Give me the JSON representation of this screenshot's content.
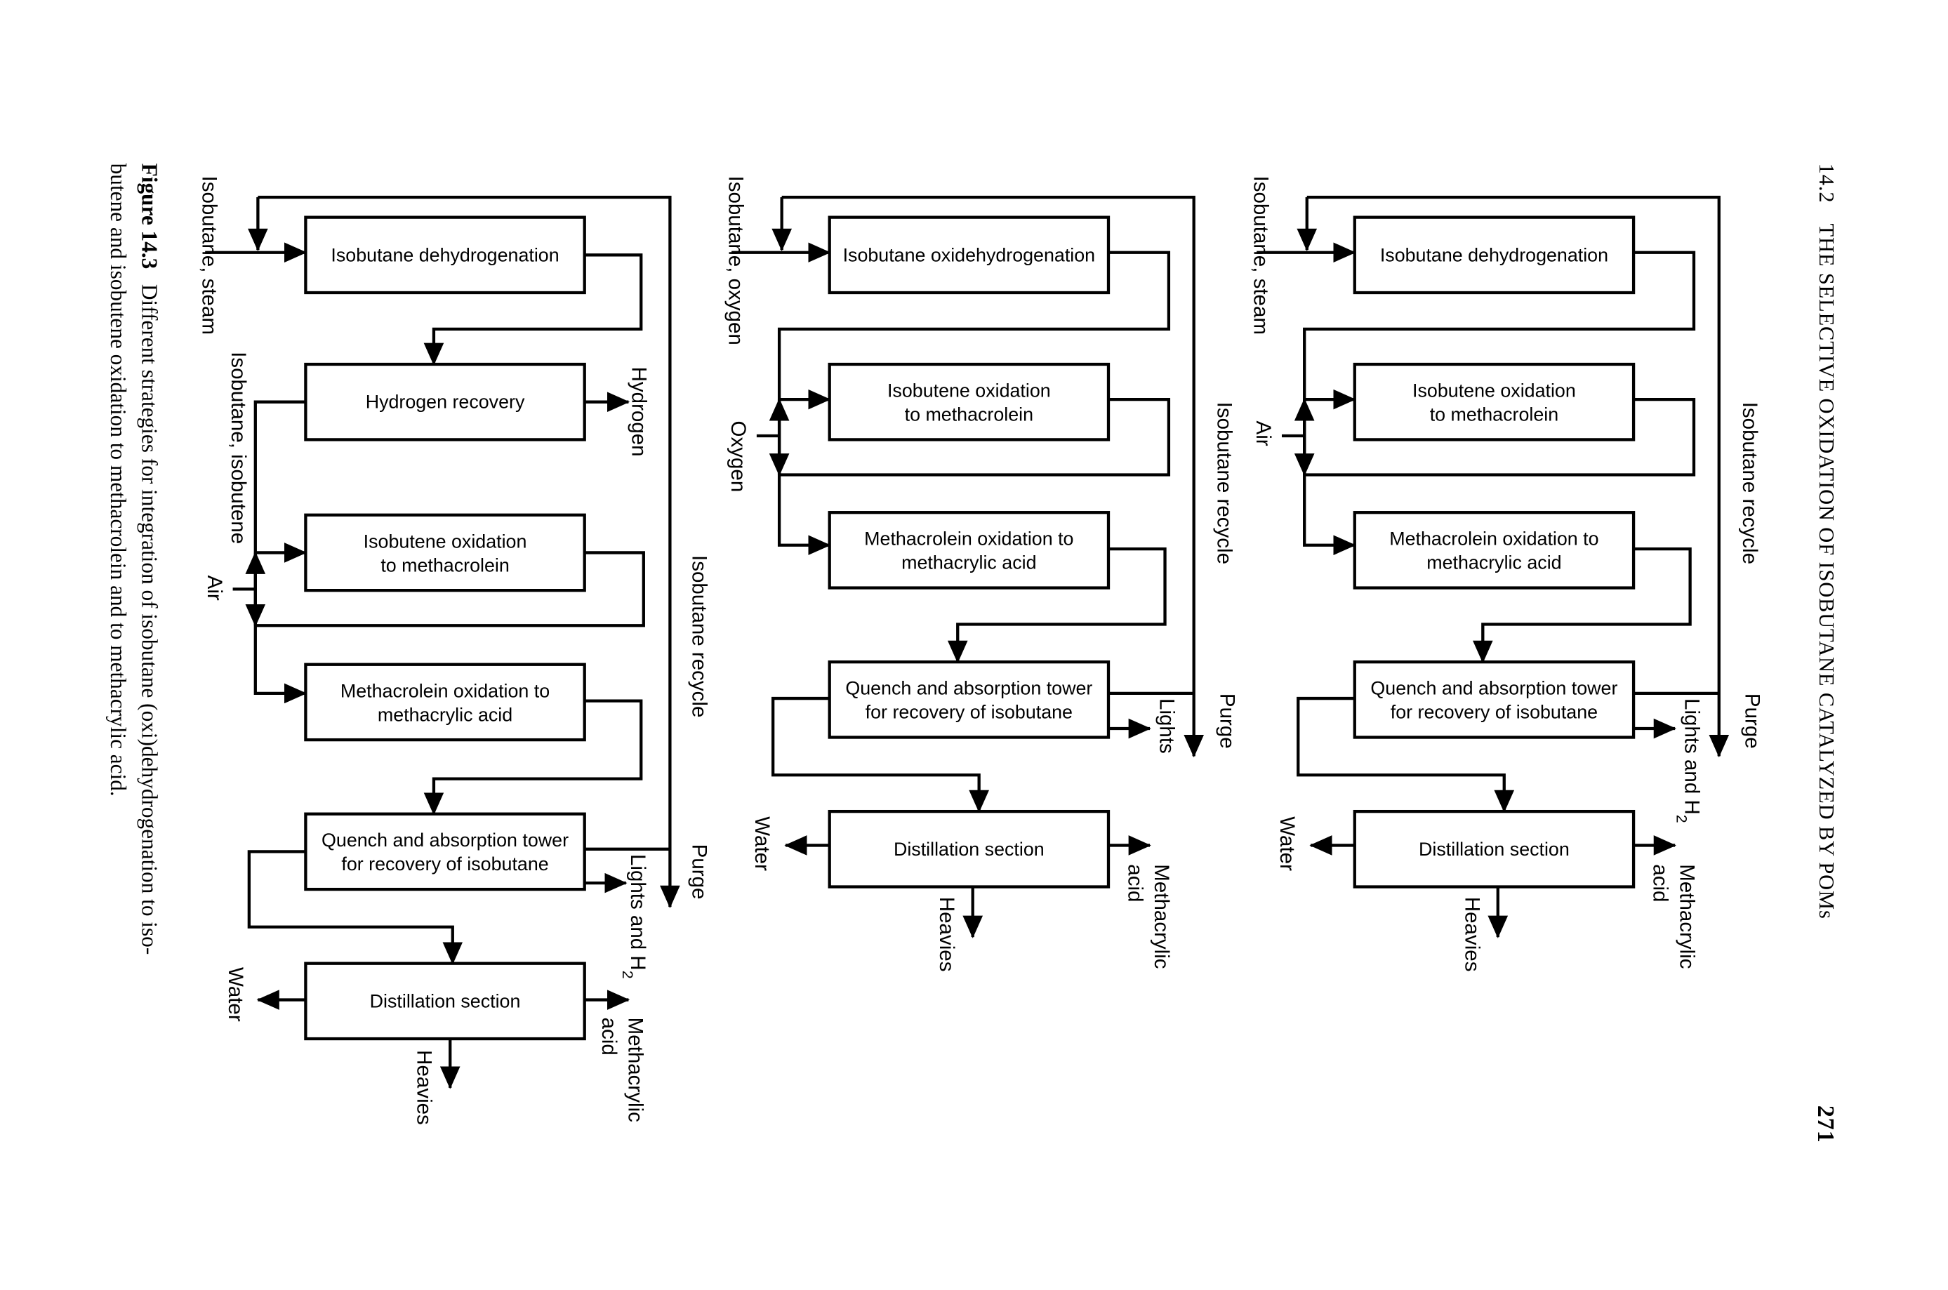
{
  "header": {
    "section": "14.2",
    "title": "THE SELECTIVE OXIDATION OF ISOBUTANE CATALYZED BY POMs",
    "page_number": "271"
  },
  "figure": {
    "label": "Figure 14.3",
    "caption_line1": "Different strategies for integration of isobutane (oxi)dehydrogenation to iso-",
    "caption_line2": "butene and isobutene oxidation to methacrolein and to methacrylic acid."
  },
  "diagrams": [
    {
      "boxes": [
        [
          "Isobutane dehydrogenation"
        ],
        [
          "Isobutene oxidation",
          "to methacrolein"
        ],
        [
          "Methacrolein oxidation to",
          "methacrylic acid"
        ],
        [
          "Quench and absorption tower",
          "for recovery of isobutane"
        ],
        [
          "Distillation section"
        ]
      ],
      "streams": {
        "feed": "Isobutane, steam",
        "oxidant": "Air",
        "recycle": "Isobutane recycle",
        "purge": "Purge",
        "lights": "Lights and H",
        "lights_sub": "2",
        "product_line1": "Methacrylic",
        "product_line2": "acid",
        "heavies": "Heavies",
        "water": "Water"
      }
    },
    {
      "boxes": [
        [
          "Isobutane oxidehydrogenation"
        ],
        [
          "Isobutene oxidation",
          "to methacrolein"
        ],
        [
          "Methacrolein oxidation to",
          "methacrylic acid"
        ],
        [
          "Quench and absorption tower",
          "for recovery of isobutane"
        ],
        [
          "Distillation section"
        ]
      ],
      "streams": {
        "feed": "Isobutane, oxygen",
        "oxidant": "Oxygen",
        "recycle": "Isobutane recycle",
        "purge": "Purge",
        "lights": "Lights",
        "product_line1": "Methacrylic",
        "product_line2": "acid",
        "heavies": "Heavies",
        "water": "Water"
      }
    },
    {
      "boxes": [
        [
          "Isobutane dehydrogenation"
        ],
        [
          "Hydrogen recovery"
        ],
        [
          "Isobutene oxidation",
          "to methacrolein"
        ],
        [
          "Methacrolein oxidation to",
          "methacrylic acid"
        ],
        [
          "Quench and absorption tower",
          "for recovery of isobutane"
        ],
        [
          "Distillation section"
        ]
      ],
      "streams": {
        "feed": "Isobutane, steam",
        "hydrogen": "Hydrogen",
        "intermediate": "Isobutane, isobutene",
        "oxidant": "Air",
        "recycle": "Isobutane recycle",
        "purge": "Purge",
        "lights": "Lights and H",
        "lights_sub": "2",
        "product_line1": "Methacrylic",
        "product_line2": "acid",
        "heavies": "Heavies",
        "water": "Water"
      }
    }
  ]
}
